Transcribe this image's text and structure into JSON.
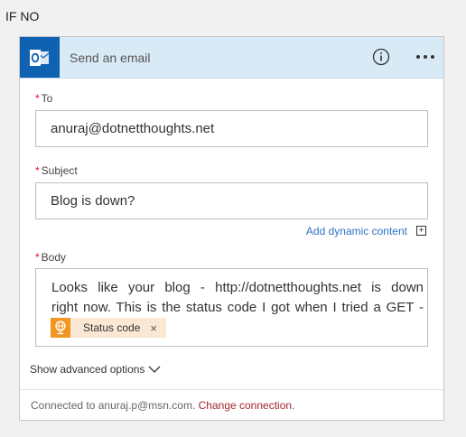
{
  "branch": {
    "label": "IF NO"
  },
  "card": {
    "title": "Send an email",
    "colors": {
      "header_bg": "#d9eaf7",
      "outlook_blue": "#0f62b1",
      "token_orange": "#f39621"
    }
  },
  "fields": {
    "to": {
      "required_mark": "*",
      "label": "To",
      "value": "anuraj@dotnetthoughts.net"
    },
    "subject": {
      "required_mark": "*",
      "label": "Subject",
      "value": "Blog is down?"
    },
    "body": {
      "required_mark": "*",
      "label": "Body",
      "line1": "Looks like your blog - http://dotnetthoughts.net is down",
      "line2": "right now. This is the status code I got when I tried a GET -",
      "token": {
        "label": "Status code",
        "close": "×",
        "icon": "http-globe-icon"
      }
    }
  },
  "dynamic_content": {
    "label": "Add dynamic content",
    "icon": "+"
  },
  "advanced": {
    "label": "Show advanced options"
  },
  "footer": {
    "prefix": "Connected to anuraj.p@msn.com.",
    "link": "Change connection",
    "suffix": "."
  }
}
